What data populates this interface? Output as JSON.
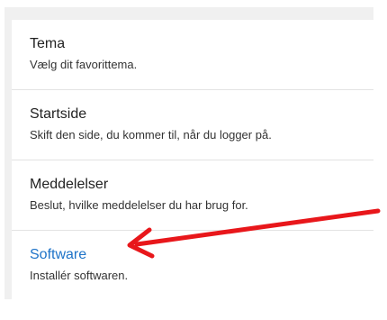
{
  "settings": {
    "items": [
      {
        "title": "Tema",
        "description": "Vælg dit favorittema."
      },
      {
        "title": "Startside",
        "description": "Skift den side, du kommer til, når du logger på."
      },
      {
        "title": "Meddelelser",
        "description": "Beslut, hvilke meddelelser du har brug for."
      },
      {
        "title": "Software",
        "description": "Installér softwaren."
      }
    ]
  },
  "colors": {
    "link": "#1e73c8",
    "annotation_arrow": "#e8171b",
    "panel_background": "#f0f0f0"
  }
}
